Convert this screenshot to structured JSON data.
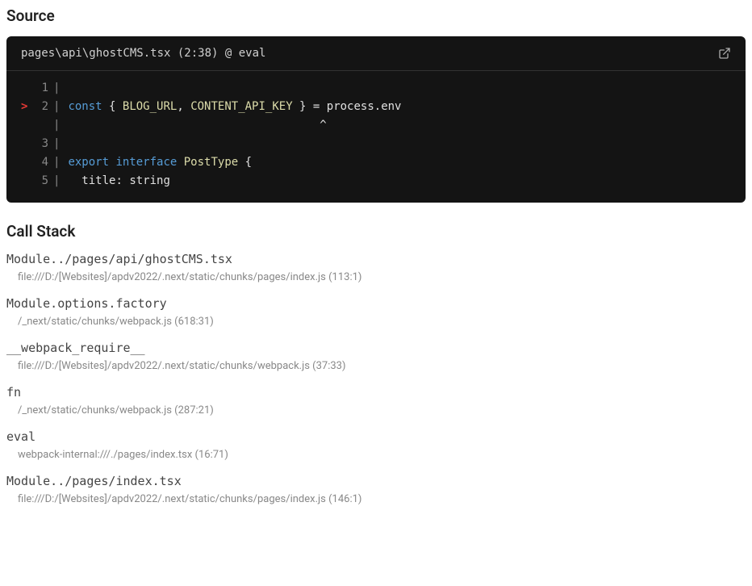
{
  "source": {
    "title": "Source",
    "header_path": "pages\\api\\ghostCMS.tsx (2:38) @ eval",
    "lines": [
      {
        "num": "1",
        "marker": "",
        "tokens": []
      },
      {
        "num": "2",
        "marker": ">",
        "tokens": [
          {
            "cls": "tok-keyword",
            "text": "const"
          },
          {
            "cls": "tok-plain",
            "text": " "
          },
          {
            "cls": "tok-brace",
            "text": "{ "
          },
          {
            "cls": "tok-var",
            "text": "BLOG_URL"
          },
          {
            "cls": "tok-punct",
            "text": ", "
          },
          {
            "cls": "tok-var",
            "text": "CONTENT_API_KEY"
          },
          {
            "cls": "tok-brace",
            "text": " }"
          },
          {
            "cls": "tok-plain",
            "text": " = process.env"
          }
        ]
      },
      {
        "num": "",
        "marker": "",
        "caret": true,
        "tokens": [
          {
            "cls": "tok-plain",
            "text": "                                     ^"
          }
        ]
      },
      {
        "num": "3",
        "marker": "",
        "tokens": []
      },
      {
        "num": "4",
        "marker": "",
        "tokens": [
          {
            "cls": "tok-keyword",
            "text": "export"
          },
          {
            "cls": "tok-plain",
            "text": " "
          },
          {
            "cls": "tok-keyword",
            "text": "interface"
          },
          {
            "cls": "tok-plain",
            "text": " "
          },
          {
            "cls": "tok-type",
            "text": "PostType"
          },
          {
            "cls": "tok-plain",
            "text": " "
          },
          {
            "cls": "tok-brace",
            "text": "{"
          }
        ]
      },
      {
        "num": "5",
        "marker": "",
        "tokens": [
          {
            "cls": "tok-plain",
            "text": "  title"
          },
          {
            "cls": "tok-punct",
            "text": ": "
          },
          {
            "cls": "tok-plain",
            "text": "string"
          }
        ]
      }
    ]
  },
  "callstack": {
    "title": "Call Stack",
    "frames": [
      {
        "name": "Module../pages/api/ghostCMS.tsx",
        "location": "file:///D:/[Websites]/apdv2022/.next/static/chunks/pages/index.js (113:1)"
      },
      {
        "name": "Module.options.factory",
        "location": "/_next/static/chunks/webpack.js (618:31)"
      },
      {
        "name": "__webpack_require__",
        "location": "file:///D:/[Websites]/apdv2022/.next/static/chunks/webpack.js (37:33)"
      },
      {
        "name": "fn",
        "location": "/_next/static/chunks/webpack.js (287:21)"
      },
      {
        "name": "eval",
        "location": "webpack-internal:///./pages/index.tsx (16:71)"
      },
      {
        "name": "Module../pages/index.tsx",
        "location": "file:///D:/[Websites]/apdv2022/.next/static/chunks/pages/index.js (146:1)"
      }
    ]
  }
}
